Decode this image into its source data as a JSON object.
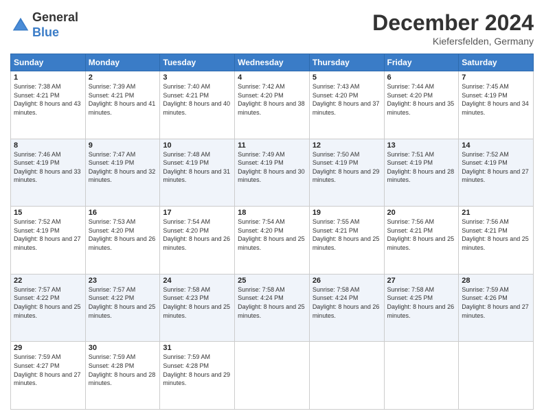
{
  "header": {
    "logo": {
      "line1": "General",
      "line2": "Blue"
    },
    "title": "December 2024",
    "location": "Kiefersfelden, Germany"
  },
  "calendar": {
    "weekdays": [
      "Sunday",
      "Monday",
      "Tuesday",
      "Wednesday",
      "Thursday",
      "Friday",
      "Saturday"
    ],
    "weeks": [
      [
        {
          "day": "1",
          "sunrise": "7:38 AM",
          "sunset": "4:21 PM",
          "daylight": "8 hours and 43 minutes."
        },
        {
          "day": "2",
          "sunrise": "7:39 AM",
          "sunset": "4:21 PM",
          "daylight": "8 hours and 41 minutes."
        },
        {
          "day": "3",
          "sunrise": "7:40 AM",
          "sunset": "4:21 PM",
          "daylight": "8 hours and 40 minutes."
        },
        {
          "day": "4",
          "sunrise": "7:42 AM",
          "sunset": "4:20 PM",
          "daylight": "8 hours and 38 minutes."
        },
        {
          "day": "5",
          "sunrise": "7:43 AM",
          "sunset": "4:20 PM",
          "daylight": "8 hours and 37 minutes."
        },
        {
          "day": "6",
          "sunrise": "7:44 AM",
          "sunset": "4:20 PM",
          "daylight": "8 hours and 35 minutes."
        },
        {
          "day": "7",
          "sunrise": "7:45 AM",
          "sunset": "4:19 PM",
          "daylight": "8 hours and 34 minutes."
        }
      ],
      [
        {
          "day": "8",
          "sunrise": "7:46 AM",
          "sunset": "4:19 PM",
          "daylight": "8 hours and 33 minutes."
        },
        {
          "day": "9",
          "sunrise": "7:47 AM",
          "sunset": "4:19 PM",
          "daylight": "8 hours and 32 minutes."
        },
        {
          "day": "10",
          "sunrise": "7:48 AM",
          "sunset": "4:19 PM",
          "daylight": "8 hours and 31 minutes."
        },
        {
          "day": "11",
          "sunrise": "7:49 AM",
          "sunset": "4:19 PM",
          "daylight": "8 hours and 30 minutes."
        },
        {
          "day": "12",
          "sunrise": "7:50 AM",
          "sunset": "4:19 PM",
          "daylight": "8 hours and 29 minutes."
        },
        {
          "day": "13",
          "sunrise": "7:51 AM",
          "sunset": "4:19 PM",
          "daylight": "8 hours and 28 minutes."
        },
        {
          "day": "14",
          "sunrise": "7:52 AM",
          "sunset": "4:19 PM",
          "daylight": "8 hours and 27 minutes."
        }
      ],
      [
        {
          "day": "15",
          "sunrise": "7:52 AM",
          "sunset": "4:19 PM",
          "daylight": "8 hours and 27 minutes."
        },
        {
          "day": "16",
          "sunrise": "7:53 AM",
          "sunset": "4:20 PM",
          "daylight": "8 hours and 26 minutes."
        },
        {
          "day": "17",
          "sunrise": "7:54 AM",
          "sunset": "4:20 PM",
          "daylight": "8 hours and 26 minutes."
        },
        {
          "day": "18",
          "sunrise": "7:54 AM",
          "sunset": "4:20 PM",
          "daylight": "8 hours and 25 minutes."
        },
        {
          "day": "19",
          "sunrise": "7:55 AM",
          "sunset": "4:21 PM",
          "daylight": "8 hours and 25 minutes."
        },
        {
          "day": "20",
          "sunrise": "7:56 AM",
          "sunset": "4:21 PM",
          "daylight": "8 hours and 25 minutes."
        },
        {
          "day": "21",
          "sunrise": "7:56 AM",
          "sunset": "4:21 PM",
          "daylight": "8 hours and 25 minutes."
        }
      ],
      [
        {
          "day": "22",
          "sunrise": "7:57 AM",
          "sunset": "4:22 PM",
          "daylight": "8 hours and 25 minutes."
        },
        {
          "day": "23",
          "sunrise": "7:57 AM",
          "sunset": "4:22 PM",
          "daylight": "8 hours and 25 minutes."
        },
        {
          "day": "24",
          "sunrise": "7:58 AM",
          "sunset": "4:23 PM",
          "daylight": "8 hours and 25 minutes."
        },
        {
          "day": "25",
          "sunrise": "7:58 AM",
          "sunset": "4:24 PM",
          "daylight": "8 hours and 25 minutes."
        },
        {
          "day": "26",
          "sunrise": "7:58 AM",
          "sunset": "4:24 PM",
          "daylight": "8 hours and 26 minutes."
        },
        {
          "day": "27",
          "sunrise": "7:58 AM",
          "sunset": "4:25 PM",
          "daylight": "8 hours and 26 minutes."
        },
        {
          "day": "28",
          "sunrise": "7:59 AM",
          "sunset": "4:26 PM",
          "daylight": "8 hours and 27 minutes."
        }
      ],
      [
        {
          "day": "29",
          "sunrise": "7:59 AM",
          "sunset": "4:27 PM",
          "daylight": "8 hours and 27 minutes."
        },
        {
          "day": "30",
          "sunrise": "7:59 AM",
          "sunset": "4:28 PM",
          "daylight": "8 hours and 28 minutes."
        },
        {
          "day": "31",
          "sunrise": "7:59 AM",
          "sunset": "4:28 PM",
          "daylight": "8 hours and 29 minutes."
        },
        null,
        null,
        null,
        null
      ]
    ]
  }
}
